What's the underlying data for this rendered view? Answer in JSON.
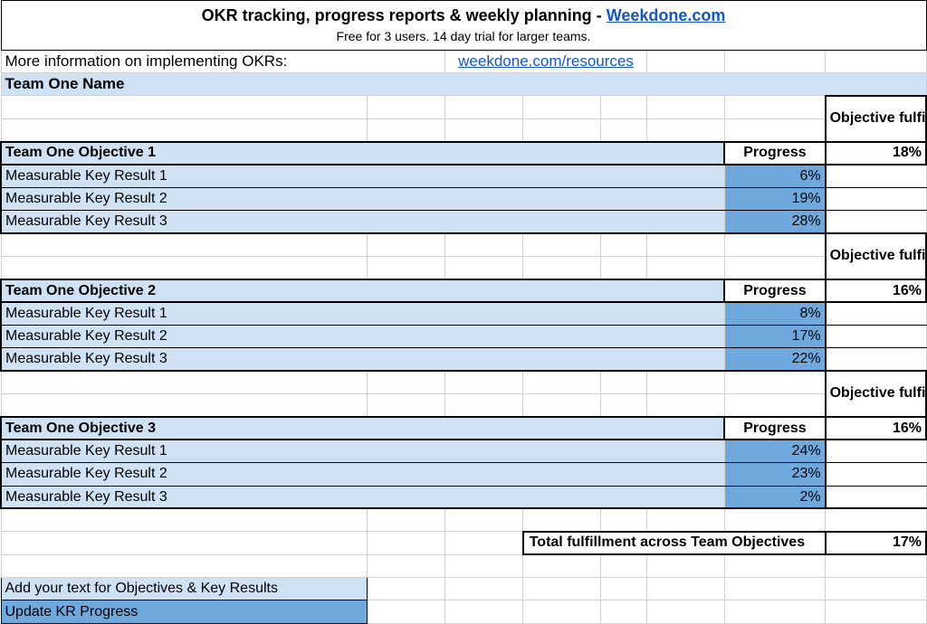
{
  "header": {
    "title_prefix": "OKR tracking, progress reports & weekly planning - ",
    "title_link": "Weekdone.com",
    "subtitle": "Free for 3 users. 14 day trial for larger teams.",
    "info_label": "More information on implementing OKRs:",
    "info_link": "weekdone.com/resources"
  },
  "team_name": "Team One Name",
  "labels": {
    "objective_fulfillment": "Objective fulfillment",
    "progress": "Progress",
    "total_label": "Total fulfillment across Team Objectives",
    "legend_objectives": "Add your text for Objectives & Key Results",
    "legend_progress": "Update KR Progress"
  },
  "objectives": [
    {
      "name": "Team One Objective 1",
      "fulfillment": "18%",
      "key_results": [
        {
          "name": "Measurable Key Result 1",
          "value": "6%"
        },
        {
          "name": "Measurable Key Result 2",
          "value": "19%"
        },
        {
          "name": "Measurable Key Result 3",
          "value": "28%"
        }
      ]
    },
    {
      "name": "Team One Objective 2",
      "fulfillment": "16%",
      "key_results": [
        {
          "name": "Measurable Key Result 1",
          "value": "8%"
        },
        {
          "name": "Measurable Key Result 2",
          "value": "17%"
        },
        {
          "name": "Measurable Key Result 3",
          "value": "22%"
        }
      ]
    },
    {
      "name": "Team One Objective 3",
      "fulfillment": "16%",
      "key_results": [
        {
          "name": "Measurable Key Result 1",
          "value": "24%"
        },
        {
          "name": "Measurable Key Result 2",
          "value": "23%"
        },
        {
          "name": "Measurable Key Result 3",
          "value": "2%"
        }
      ]
    }
  ],
  "total_fulfillment": "17%"
}
